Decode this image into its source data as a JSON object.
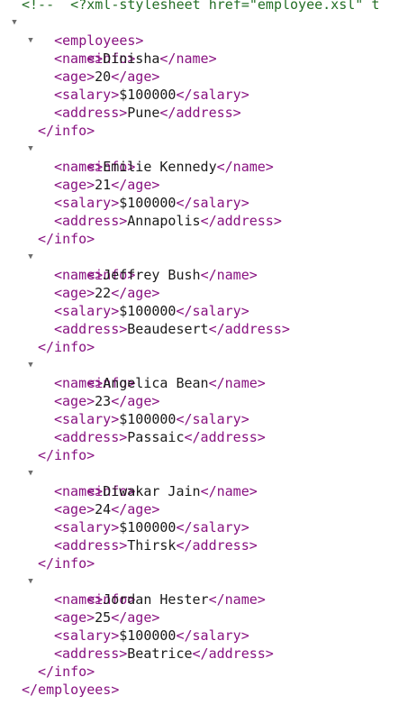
{
  "comment": "<!--  <?xml-stylesheet href=\"employee.xsl\" t",
  "root": {
    "open": "<employees>",
    "close": "</employees>"
  },
  "tags": {
    "info_open": "<info>",
    "info_close": "</info>",
    "name_open": "<name>",
    "name_close": "</name>",
    "age_open": "<age>",
    "age_close": "</age>",
    "salary_open": "<salary>",
    "salary_close": "</salary>",
    "address_open": "<address>",
    "address_close": "</address>"
  },
  "toggle_icon": "triangle-down-icon",
  "colors": {
    "tag": "#881280",
    "comment": "#236e25",
    "text": "#1a1a1a",
    "toggle": "#6e6e6e"
  },
  "employees": [
    {
      "name": "Dinisha",
      "age": "20",
      "salary": "$100000",
      "address": "Pune"
    },
    {
      "name": "Emilie Kennedy",
      "age": "21",
      "salary": "$100000",
      "address": "Annapolis"
    },
    {
      "name": "Jeffrey Bush",
      "age": "22",
      "salary": "$100000",
      "address": "Beaudesert"
    },
    {
      "name": "Angelica Bean",
      "age": "23",
      "salary": "$100000",
      "address": "Passaic"
    },
    {
      "name": "Diwakar Jain",
      "age": "24",
      "salary": "$100000",
      "address": "Thirsk"
    },
    {
      "name": "Jordan Hester",
      "age": "25",
      "salary": "$100000",
      "address": "Beatrice"
    }
  ]
}
